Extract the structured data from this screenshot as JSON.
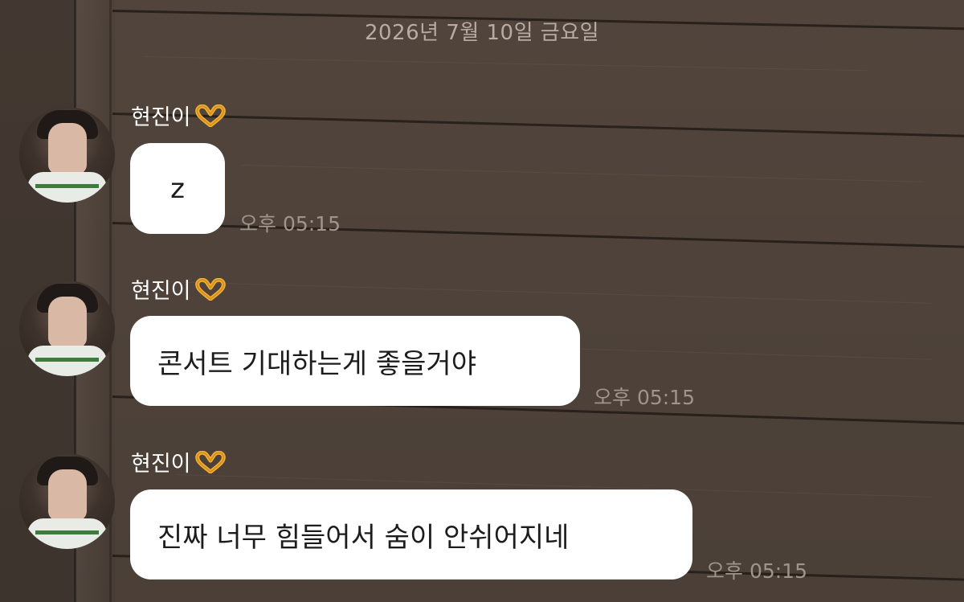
{
  "chat": {
    "date_header": "2026년 7월 10일 금요일",
    "messages": [
      {
        "sender": "현진이",
        "sender_emoji_icon": "heart-hands-icon",
        "text": "z",
        "time": "오후 05:15"
      },
      {
        "sender": "현진이",
        "sender_emoji_icon": "heart-hands-icon",
        "text": "콘서트 기대하는게 좋을거야",
        "time": "오후 05:15"
      },
      {
        "sender": "현진이",
        "sender_emoji_icon": "heart-hands-icon",
        "text": "진짜 너무 힘들어서 숨이 안쉬어지네",
        "time": "오후 05:15"
      }
    ]
  },
  "colors": {
    "bubble": "#ffffff",
    "timestamp": "#9f958d",
    "date_header": "#b6aca4",
    "sender_name": "#ffffff",
    "background": "#55483f"
  }
}
